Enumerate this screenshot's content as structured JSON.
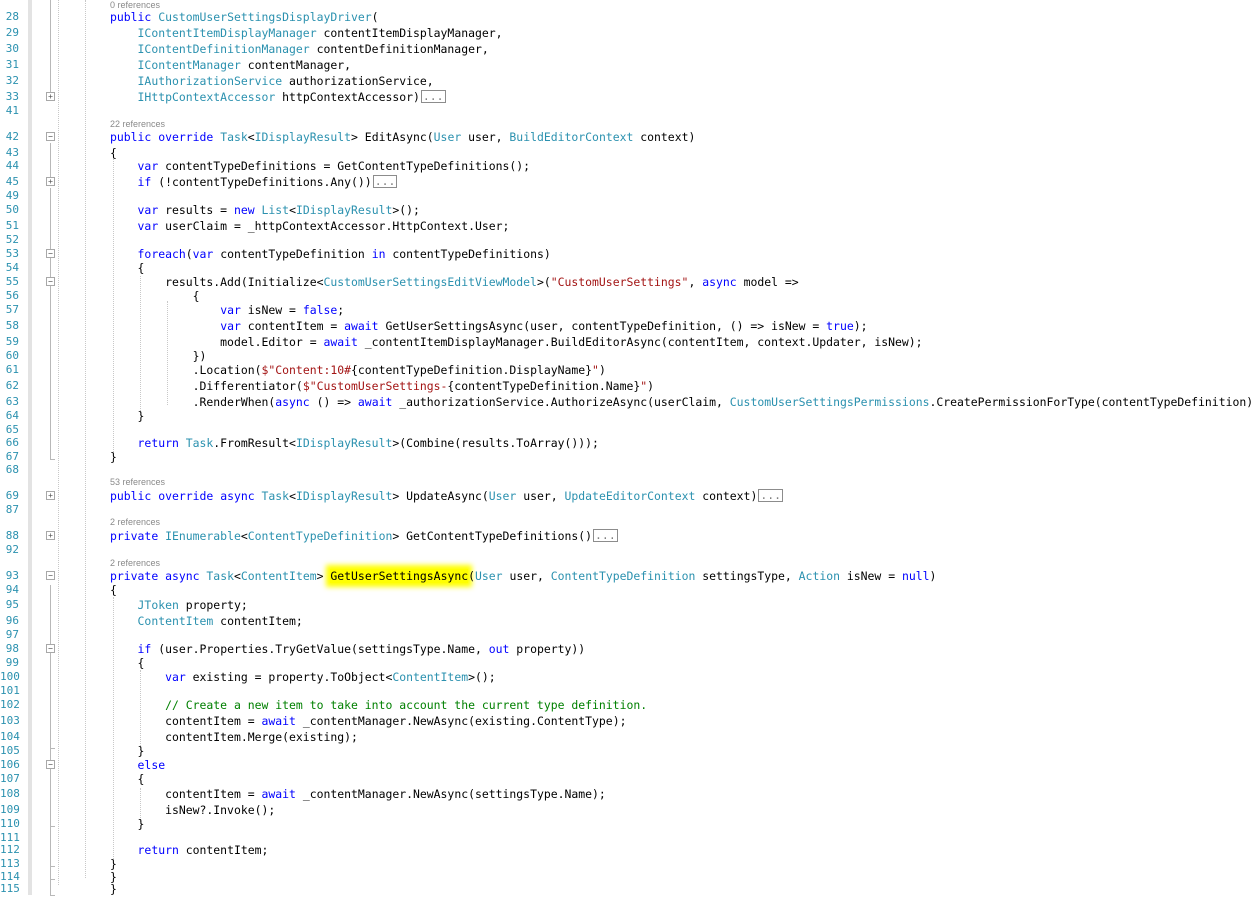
{
  "editor": {
    "line_numbers": [
      "28",
      "29",
      "30",
      "31",
      "32",
      "33",
      "41",
      "42",
      "43",
      "44",
      "45",
      "49",
      "50",
      "51",
      "52",
      "53",
      "54",
      "55",
      "56",
      "57",
      "58",
      "59",
      "60",
      "61",
      "62",
      "63",
      "64",
      "65",
      "66",
      "67",
      "68",
      "69",
      "87",
      "88",
      "92",
      "93",
      "94",
      "95",
      "96",
      "97",
      "98",
      "99",
      "100",
      "101",
      "102",
      "103",
      "104",
      "105",
      "106",
      "107",
      "108",
      "109",
      "110",
      "111",
      "112",
      "113",
      "114",
      "115"
    ],
    "codelens": [
      "0 references",
      "22 references",
      "53 references",
      "2 references",
      "2 references"
    ],
    "collapsed_marker": "...",
    "highlighted_symbol": "GetUserSettingsAsync",
    "colors": {
      "keyword": "#0000ff",
      "type": "#2b91af",
      "string": "#a31515",
      "comment": "#008000",
      "highlight": "#ffff00"
    },
    "code_lines": [
      [
        {
          "t": "public ",
          "c": "kw"
        },
        {
          "t": "CustomUserSettingsDisplayDriver",
          "c": "ty"
        },
        {
          "t": "("
        }
      ],
      [
        {
          "t": "    "
        },
        {
          "t": "IContentItemDisplayManager",
          "c": "ty"
        },
        {
          "t": " contentItemDisplayManager,"
        }
      ],
      [
        {
          "t": "    "
        },
        {
          "t": "IContentDefinitionManager",
          "c": "ty"
        },
        {
          "t": " contentDefinitionManager,"
        }
      ],
      [
        {
          "t": "    "
        },
        {
          "t": "IContentManager",
          "c": "ty"
        },
        {
          "t": " contentManager,"
        }
      ],
      [
        {
          "t": "    "
        },
        {
          "t": "IAuthorizationService",
          "c": "ty"
        },
        {
          "t": " authorizationService,"
        }
      ],
      [
        {
          "t": "    "
        },
        {
          "t": "IHttpContextAccessor",
          "c": "ty"
        },
        {
          "t": " httpContextAccessor)"
        },
        {
          "t": "...",
          "c": "col"
        }
      ],
      [],
      [
        {
          "t": "public ",
          "c": "kw"
        },
        {
          "t": "override ",
          "c": "kw"
        },
        {
          "t": "Task",
          "c": "ty"
        },
        {
          "t": "<"
        },
        {
          "t": "IDisplayResult",
          "c": "ty"
        },
        {
          "t": "> EditAsync("
        },
        {
          "t": "User",
          "c": "ty"
        },
        {
          "t": " user, "
        },
        {
          "t": "BuildEditorContext",
          "c": "ty"
        },
        {
          "t": " context)"
        }
      ],
      [
        {
          "t": "{"
        }
      ],
      [
        {
          "t": "    "
        },
        {
          "t": "var ",
          "c": "kw"
        },
        {
          "t": "contentTypeDefinitions = GetContentTypeDefinitions();"
        }
      ],
      [
        {
          "t": "    "
        },
        {
          "t": "if ",
          "c": "kw"
        },
        {
          "t": "(!contentTypeDefinitions.Any())"
        },
        {
          "t": "...",
          "c": "col"
        }
      ],
      [],
      [
        {
          "t": "    "
        },
        {
          "t": "var ",
          "c": "kw"
        },
        {
          "t": "results = "
        },
        {
          "t": "new ",
          "c": "kw"
        },
        {
          "t": "List",
          "c": "ty"
        },
        {
          "t": "<"
        },
        {
          "t": "IDisplayResult",
          "c": "ty"
        },
        {
          "t": ">();"
        }
      ],
      [
        {
          "t": "    "
        },
        {
          "t": "var ",
          "c": "kw"
        },
        {
          "t": "userClaim = _httpContextAccessor.HttpContext.User;"
        }
      ],
      [],
      [
        {
          "t": "    "
        },
        {
          "t": "foreach",
          "c": "kw"
        },
        {
          "t": "("
        },
        {
          "t": "var ",
          "c": "kw"
        },
        {
          "t": "contentTypeDefinition "
        },
        {
          "t": "in ",
          "c": "kw"
        },
        {
          "t": "contentTypeDefinitions)"
        }
      ],
      [
        {
          "t": "    {"
        }
      ],
      [
        {
          "t": "        results.Add(Initialize<"
        },
        {
          "t": "CustomUserSettingsEditViewModel",
          "c": "ty"
        },
        {
          "t": ">("
        },
        {
          "t": "\"CustomUserSettings\"",
          "c": "st"
        },
        {
          "t": ", "
        },
        {
          "t": "async ",
          "c": "kw"
        },
        {
          "t": "model =>"
        }
      ],
      [
        {
          "t": "            {"
        }
      ],
      [
        {
          "t": "                "
        },
        {
          "t": "var ",
          "c": "kw"
        },
        {
          "t": "isNew = "
        },
        {
          "t": "false",
          "c": "kw"
        },
        {
          "t": ";"
        }
      ],
      [
        {
          "t": "                "
        },
        {
          "t": "var ",
          "c": "kw"
        },
        {
          "t": "contentItem = "
        },
        {
          "t": "await ",
          "c": "kw"
        },
        {
          "t": "GetUserSettingsAsync(user, contentTypeDefinition, () => isNew = "
        },
        {
          "t": "true",
          "c": "kw"
        },
        {
          "t": ");"
        }
      ],
      [
        {
          "t": "                model.Editor = "
        },
        {
          "t": "await ",
          "c": "kw"
        },
        {
          "t": "_contentItemDisplayManager.BuildEditorAsync(contentItem, context.Updater, isNew);"
        }
      ],
      [
        {
          "t": "            })"
        }
      ],
      [
        {
          "t": "            .Location("
        },
        {
          "t": "$\"Content:10#",
          "c": "st"
        },
        {
          "t": "{contentTypeDefinition.DisplayName}"
        },
        {
          "t": "\"",
          "c": "st"
        },
        {
          "t": ")"
        }
      ],
      [
        {
          "t": "            .Differentiator("
        },
        {
          "t": "$\"CustomUserSettings-",
          "c": "st"
        },
        {
          "t": "{contentTypeDefinition.Name}"
        },
        {
          "t": "\"",
          "c": "st"
        },
        {
          "t": ")"
        }
      ],
      [
        {
          "t": "            .RenderWhen("
        },
        {
          "t": "async ",
          "c": "kw"
        },
        {
          "t": "() => "
        },
        {
          "t": "await ",
          "c": "kw"
        },
        {
          "t": "_authorizationService.AuthorizeAsync(userClaim, "
        },
        {
          "t": "CustomUserSettingsPermissions",
          "c": "ty"
        },
        {
          "t": ".CreatePermissionForType(contentTypeDefinition))));"
        }
      ],
      [
        {
          "t": "    }"
        }
      ],
      [],
      [
        {
          "t": "    "
        },
        {
          "t": "return ",
          "c": "kw"
        },
        {
          "t": "Task",
          "c": "ty"
        },
        {
          "t": ".FromResult<"
        },
        {
          "t": "IDisplayResult",
          "c": "ty"
        },
        {
          "t": ">(Combine(results.ToArray()));"
        }
      ],
      [
        {
          "t": "}"
        }
      ],
      [],
      [
        {
          "t": "public ",
          "c": "kw"
        },
        {
          "t": "override ",
          "c": "kw"
        },
        {
          "t": "async ",
          "c": "kw"
        },
        {
          "t": "Task",
          "c": "ty"
        },
        {
          "t": "<"
        },
        {
          "t": "IDisplayResult",
          "c": "ty"
        },
        {
          "t": "> UpdateAsync("
        },
        {
          "t": "User",
          "c": "ty"
        },
        {
          "t": " user, "
        },
        {
          "t": "UpdateEditorContext",
          "c": "ty"
        },
        {
          "t": " context)"
        },
        {
          "t": "...",
          "c": "col"
        }
      ],
      [],
      [
        {
          "t": "private ",
          "c": "kw"
        },
        {
          "t": "IEnumerable",
          "c": "ty"
        },
        {
          "t": "<"
        },
        {
          "t": "ContentTypeDefinition",
          "c": "ty"
        },
        {
          "t": "> GetContentTypeDefinitions()"
        },
        {
          "t": "...",
          "c": "col"
        }
      ],
      [],
      [
        {
          "t": "private ",
          "c": "kw"
        },
        {
          "t": "async ",
          "c": "kw"
        },
        {
          "t": "Task",
          "c": "ty"
        },
        {
          "t": "<"
        },
        {
          "t": "ContentItem",
          "c": "ty"
        },
        {
          "t": "> "
        },
        {
          "t": "GetUserSettingsAsync",
          "c": "hl"
        },
        {
          "t": "("
        },
        {
          "t": "User",
          "c": "ty"
        },
        {
          "t": " user, "
        },
        {
          "t": "ContentTypeDefinition",
          "c": "ty"
        },
        {
          "t": " settingsType, "
        },
        {
          "t": "Action",
          "c": "ty"
        },
        {
          "t": " isNew = "
        },
        {
          "t": "null",
          "c": "kw"
        },
        {
          "t": ")"
        }
      ],
      [
        {
          "t": "{"
        }
      ],
      [
        {
          "t": "    "
        },
        {
          "t": "JToken",
          "c": "ty"
        },
        {
          "t": " property;"
        }
      ],
      [
        {
          "t": "    "
        },
        {
          "t": "ContentItem",
          "c": "ty"
        },
        {
          "t": " contentItem;"
        }
      ],
      [],
      [
        {
          "t": "    "
        },
        {
          "t": "if ",
          "c": "kw"
        },
        {
          "t": "(user.Properties.TryGetValue(settingsType.Name, "
        },
        {
          "t": "out ",
          "c": "kw"
        },
        {
          "t": "property))"
        }
      ],
      [
        {
          "t": "    {"
        }
      ],
      [
        {
          "t": "        "
        },
        {
          "t": "var ",
          "c": "kw"
        },
        {
          "t": "existing = property.ToObject<"
        },
        {
          "t": "ContentItem",
          "c": "ty"
        },
        {
          "t": ">();"
        }
      ],
      [],
      [
        {
          "t": "        "
        },
        {
          "t": "// Create a new item to take into account the current type definition.",
          "c": "cm"
        }
      ],
      [
        {
          "t": "        contentItem = "
        },
        {
          "t": "await ",
          "c": "kw"
        },
        {
          "t": "_contentManager.NewAsync(existing.ContentType);"
        }
      ],
      [
        {
          "t": "        contentItem.Merge(existing);"
        }
      ],
      [
        {
          "t": "    }"
        }
      ],
      [
        {
          "t": "    "
        },
        {
          "t": "else",
          "c": "kw"
        }
      ],
      [
        {
          "t": "    {"
        }
      ],
      [
        {
          "t": "        contentItem = "
        },
        {
          "t": "await ",
          "c": "kw"
        },
        {
          "t": "_contentManager.NewAsync(settingsType.Name);"
        }
      ],
      [
        {
          "t": "        isNew?.Invoke();"
        }
      ],
      [
        {
          "t": "    }"
        }
      ],
      [],
      [
        {
          "t": "    "
        },
        {
          "t": "return ",
          "c": "kw"
        },
        {
          "t": "contentItem;"
        }
      ],
      [
        {
          "t": "}"
        }
      ],
      [
        {
          "t": "}"
        }
      ],
      [
        {
          "t": "}"
        }
      ]
    ]
  }
}
